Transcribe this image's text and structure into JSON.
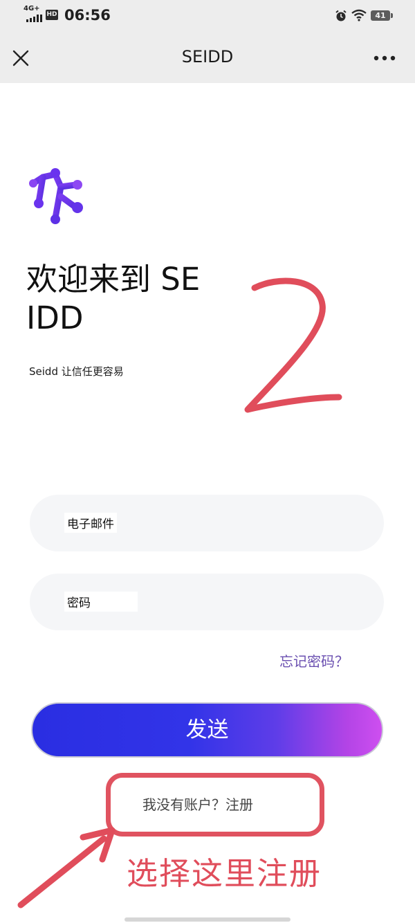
{
  "status_bar": {
    "network": "4G+",
    "hd": "HD",
    "time": "06:56",
    "battery": "41"
  },
  "nav": {
    "title": "SEIDD"
  },
  "welcome": {
    "line1": "欢迎来到 SE",
    "line2": "IDD",
    "tagline": "Seidd 让信任更容易"
  },
  "form": {
    "email_placeholder": "电子邮件",
    "password_placeholder": "密码",
    "forgot_link": "忘记密码？",
    "send_button": "发送",
    "register_link": "我没有账户？注册"
  },
  "annotations": {
    "step_number": "2",
    "hint": "选择这里注册",
    "color": "#e04d5b"
  },
  "colors": {
    "gradient_start": "#2a2ee2",
    "gradient_end": "#ce4ff0",
    "link": "#6a4fb0"
  }
}
